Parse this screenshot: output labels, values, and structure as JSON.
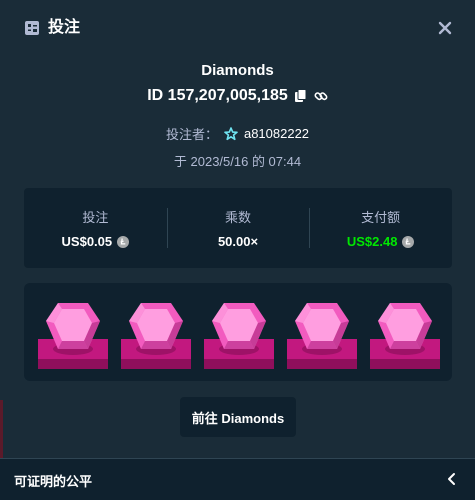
{
  "header": {
    "title": "投注",
    "icon": "bet-slip-icon",
    "close_icon": "close-icon"
  },
  "bet": {
    "game_name": "Diamonds",
    "id_text": "ID 157,207,005,185",
    "copy_icon": "copy-icon",
    "link_icon": "link-icon",
    "bettor_label": "投注者：",
    "bettor_icon": "vip-star-icon",
    "bettor_name": "a81082222",
    "date_text": "于 2023/5/16 的 07:44"
  },
  "stats": [
    {
      "label": "投注",
      "value": "US$0.05",
      "coin": true,
      "color": "#ffffff"
    },
    {
      "label": "乘数",
      "value": "50.00×",
      "coin": false,
      "color": "#ffffff"
    },
    {
      "label": "支付额",
      "value": "US$2.48",
      "coin": true,
      "color": "#00e701"
    }
  ],
  "board": {
    "gem_count": 5,
    "gem_type": "pink-diamond",
    "colors": {
      "gem_light": "#ff9ee0",
      "gem_mid": "#f25bbf",
      "gem_dark": "#c73c98",
      "base_top": "#c2187f",
      "base_side": "#8f0f5c"
    }
  },
  "go_button": {
    "label": "前往 Diamonds"
  },
  "footer": {
    "label": "可证明的公平",
    "chevron_icon": "chevron-left-icon"
  },
  "colors": {
    "background": "#1a2c38",
    "panel": "#0f212e",
    "muted_text": "#b1bad3",
    "win_green": "#00e701"
  }
}
